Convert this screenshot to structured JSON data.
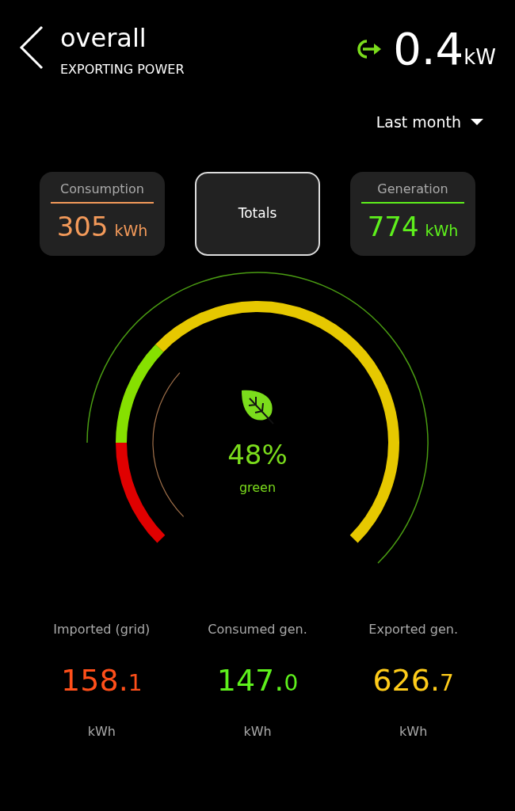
{
  "header": {
    "title": "overall",
    "subtitle": "EXPORTING POWER",
    "power_value": "0.4",
    "power_unit": "kW"
  },
  "period": {
    "label": "Last month"
  },
  "cards": [
    {
      "kind": "stat",
      "label": "Consumption",
      "value": "305",
      "unit": "kWh",
      "color": "#f39a5a",
      "selected": false
    },
    {
      "kind": "toggle",
      "label": "Totals",
      "selected": true
    },
    {
      "kind": "stat",
      "label": "Generation",
      "value": "774",
      "unit": "kWh",
      "color": "#5ef01c",
      "selected": false
    }
  ],
  "gauge": {
    "percent": "48%",
    "caption": "green",
    "segments": [
      {
        "color": "#e00000"
      },
      {
        "color": "#86e000"
      },
      {
        "color": "#e6c800"
      }
    ]
  },
  "totals": [
    {
      "label": "Imported (grid)",
      "whole": "158.",
      "fraction": "1",
      "unit": "kWh",
      "color": "#ff4f1a"
    },
    {
      "label": "Consumed gen.",
      "whole": "147.",
      "fraction": "0",
      "unit": "kWh",
      "color": "#5ef01c"
    },
    {
      "label": "Exported gen.",
      "whole": "626.",
      "fraction": "7",
      "unit": "kWh",
      "color": "#ffcc1a"
    }
  ]
}
